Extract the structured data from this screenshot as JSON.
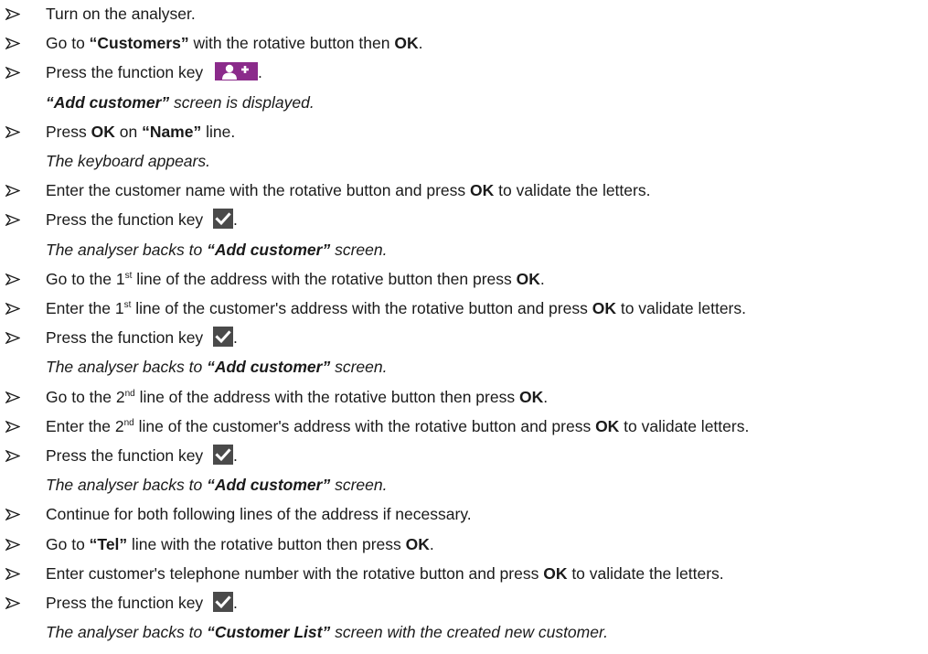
{
  "steps": [
    {
      "type": "step",
      "parts": [
        {
          "t": "Turn on the analyser."
        }
      ]
    },
    {
      "type": "step",
      "parts": [
        {
          "t": "Go to "
        },
        {
          "t": "“Customers”",
          "b": true
        },
        {
          "t": " with the rotative button then "
        },
        {
          "t": "OK",
          "b": true
        },
        {
          "t": "."
        }
      ]
    },
    {
      "type": "step",
      "parts": [
        {
          "t": "Press the function key "
        },
        {
          "icon": "add-user-icon"
        },
        {
          "t": "."
        }
      ]
    },
    {
      "type": "note",
      "parts": [
        {
          "t": "“Add customer”",
          "b": true
        },
        {
          "t": " screen is displayed."
        }
      ]
    },
    {
      "type": "step",
      "parts": [
        {
          "t": "Press "
        },
        {
          "t": "OK",
          "b": true
        },
        {
          "t": " on "
        },
        {
          "t": "“Name”",
          "b": true
        },
        {
          "t": " line."
        }
      ]
    },
    {
      "type": "note",
      "parts": [
        {
          "t": "The keyboard appears."
        }
      ]
    },
    {
      "type": "step",
      "parts": [
        {
          "t": "Enter the customer name with the rotative button and press "
        },
        {
          "t": "OK",
          "b": true
        },
        {
          "t": " to validate the letters."
        }
      ]
    },
    {
      "type": "step",
      "parts": [
        {
          "t": "Press the function key "
        },
        {
          "icon": "checkmark-icon"
        },
        {
          "t": "."
        }
      ]
    },
    {
      "type": "note",
      "parts": [
        {
          "t": "The analyser backs to "
        },
        {
          "t": "“Add customer”",
          "b": true
        },
        {
          "t": " screen."
        }
      ]
    },
    {
      "type": "step",
      "parts": [
        {
          "t": "Go to the 1"
        },
        {
          "t": "st",
          "sup": true
        },
        {
          "t": " line of the address with the rotative button then press "
        },
        {
          "t": "OK",
          "b": true
        },
        {
          "t": "."
        }
      ]
    },
    {
      "type": "step",
      "parts": [
        {
          "t": "Enter the 1"
        },
        {
          "t": "st",
          "sup": true
        },
        {
          "t": " line of the customer's address with the rotative button and press "
        },
        {
          "t": "OK",
          "b": true
        },
        {
          "t": " to validate letters."
        }
      ]
    },
    {
      "type": "step",
      "parts": [
        {
          "t": "Press the function key "
        },
        {
          "icon": "checkmark-icon"
        },
        {
          "t": "."
        }
      ]
    },
    {
      "type": "note",
      "parts": [
        {
          "t": "The analyser backs to "
        },
        {
          "t": "“Add customer”",
          "b": true
        },
        {
          "t": " screen."
        }
      ]
    },
    {
      "type": "step",
      "parts": [
        {
          "t": "Go to the 2"
        },
        {
          "t": "nd",
          "sup": true
        },
        {
          "t": " line of the address with the rotative button then press "
        },
        {
          "t": "OK",
          "b": true
        },
        {
          "t": "."
        }
      ]
    },
    {
      "type": "step",
      "parts": [
        {
          "t": "Enter the 2"
        },
        {
          "t": "nd",
          "sup": true
        },
        {
          "t": " line of the customer's address with the rotative button and press "
        },
        {
          "t": "OK",
          "b": true
        },
        {
          "t": " to validate letters."
        }
      ]
    },
    {
      "type": "step",
      "parts": [
        {
          "t": "Press the function key "
        },
        {
          "icon": "checkmark-icon"
        },
        {
          "t": "."
        }
      ]
    },
    {
      "type": "note",
      "parts": [
        {
          "t": "The analyser backs to "
        },
        {
          "t": "“Add customer”",
          "b": true
        },
        {
          "t": " screen."
        }
      ]
    },
    {
      "type": "step",
      "parts": [
        {
          "t": "Continue for both following lines of the address if necessary."
        }
      ]
    },
    {
      "type": "step",
      "parts": [
        {
          "t": "Go to "
        },
        {
          "t": "“Tel”",
          "b": true
        },
        {
          "t": " line with the rotative button then press "
        },
        {
          "t": "OK",
          "b": true
        },
        {
          "t": "."
        }
      ]
    },
    {
      "type": "step",
      "parts": [
        {
          "t": "Enter customer's telephone number with the rotative button and press "
        },
        {
          "t": "OK",
          "b": true
        },
        {
          "t": " to validate the letters."
        }
      ]
    },
    {
      "type": "step",
      "parts": [
        {
          "t": "Press the function key "
        },
        {
          "icon": "checkmark-icon"
        },
        {
          "t": "."
        }
      ]
    },
    {
      "type": "note",
      "parts": [
        {
          "t": "The analyser backs to "
        },
        {
          "t": "“Customer List”",
          "b": true
        },
        {
          "t": " screen  with the created new customer."
        }
      ]
    }
  ],
  "colors": {
    "text": "#1a1a1a",
    "add_user_key": "#8b2b8b",
    "check_key": "#4a4a4a"
  }
}
